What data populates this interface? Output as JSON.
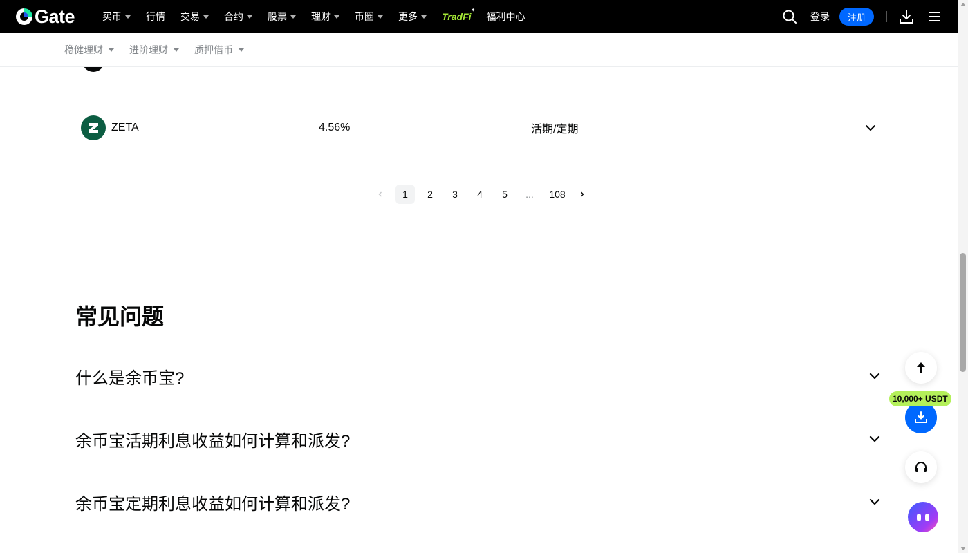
{
  "brand": {
    "name": "Gate",
    "accent": "#0068ff",
    "highlight": "#b4f05a"
  },
  "topnav": {
    "items": [
      {
        "label": "买币",
        "dropdown": true
      },
      {
        "label": "行情",
        "dropdown": false
      },
      {
        "label": "交易",
        "dropdown": true
      },
      {
        "label": "合约",
        "dropdown": true
      },
      {
        "label": "股票",
        "dropdown": true
      },
      {
        "label": "理财",
        "dropdown": true
      },
      {
        "label": "币圈",
        "dropdown": true
      },
      {
        "label": "更多",
        "dropdown": true
      }
    ],
    "tradfi": "TradFi",
    "welfare": "福利中心",
    "login": "登录",
    "register": "注册"
  },
  "subnav": {
    "items": [
      {
        "label": "稳健理财"
      },
      {
        "label": "进阶理财"
      },
      {
        "label": "质押借币"
      }
    ]
  },
  "coin_row": {
    "name": "ZETA",
    "apr": "4.56%",
    "type": "活期/定期",
    "logo_color": "#0c5d42"
  },
  "pagination": {
    "pages": [
      "1",
      "2",
      "3",
      "4",
      "5"
    ],
    "ellipsis": "...",
    "last": "108",
    "current": 1
  },
  "faq": {
    "title": "常见问题",
    "questions": [
      "什么是余币宝?",
      "余币宝活期利息收益如何计算和派发?",
      "余币宝定期利息收益如何计算和派发?"
    ]
  },
  "floating": {
    "badge": "10,000+ USDT"
  }
}
